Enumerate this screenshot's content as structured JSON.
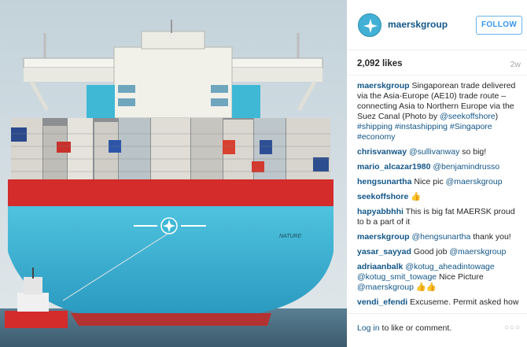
{
  "account": {
    "username": "maerskgroup",
    "follow_label": "FOLLOW"
  },
  "post": {
    "likes": "2,092 likes",
    "age": "2w"
  },
  "caption": {
    "user": "maerskgroup",
    "text": "Singaporean trade delivered via the Asia-Europe (AE10) trade route – connecting Asia to Northern Europe via the Suez Canal (Photo by ",
    "mention": "@seekoffshore",
    "text2": ") ",
    "hashtags": "#shipping #instashipping #Singapore #economy"
  },
  "comments": [
    {
      "user": "chrisvanway",
      "mention": "@sullivanway",
      "text": " so big!"
    },
    {
      "user": "mario_alcazar1980",
      "mention": "@benjamindrusso",
      "text": ""
    },
    {
      "user": "hengsunartha",
      "mention": "",
      "text": "Nice pic ",
      "mention2": "@maerskgroup"
    },
    {
      "user": "seekoffshore",
      "mention": "",
      "text": "👍"
    },
    {
      "user": "hapyabbhhi",
      "mention": "",
      "text": "This is big fat MAERSK proud to b a part of it"
    },
    {
      "user": "maerskgroup",
      "mention": "@hengsunartha",
      "text": " thank you!"
    },
    {
      "user": "yasar_sayyad",
      "mention": "",
      "text": "Good job ",
      "mention2": "@maerskgroup"
    },
    {
      "user": "adriaanbalk",
      "mention": "@kotug_aheadintowage @kotug_smit_towage",
      "text": " Nice Picture ",
      "mention2": "@maerskgroup",
      "tail": " 👍👍"
    },
    {
      "user": "vendi_efendi",
      "mention": "",
      "text": "Excuseme. Permit asked how much time in operation"
    }
  ],
  "footer": {
    "login_link": "Log in",
    "login_text": " to like or comment.",
    "more": "○○○"
  },
  "photo": {
    "hull_name": "NATURE",
    "colors": {
      "hull_blue": "#3fb8d6",
      "hull_red": "#d42b2b",
      "sky": "#cdd9df",
      "water": "#4a6f86"
    }
  },
  "icons": {
    "avatar": "maersk-star-icon",
    "more": "more-options-icon"
  }
}
